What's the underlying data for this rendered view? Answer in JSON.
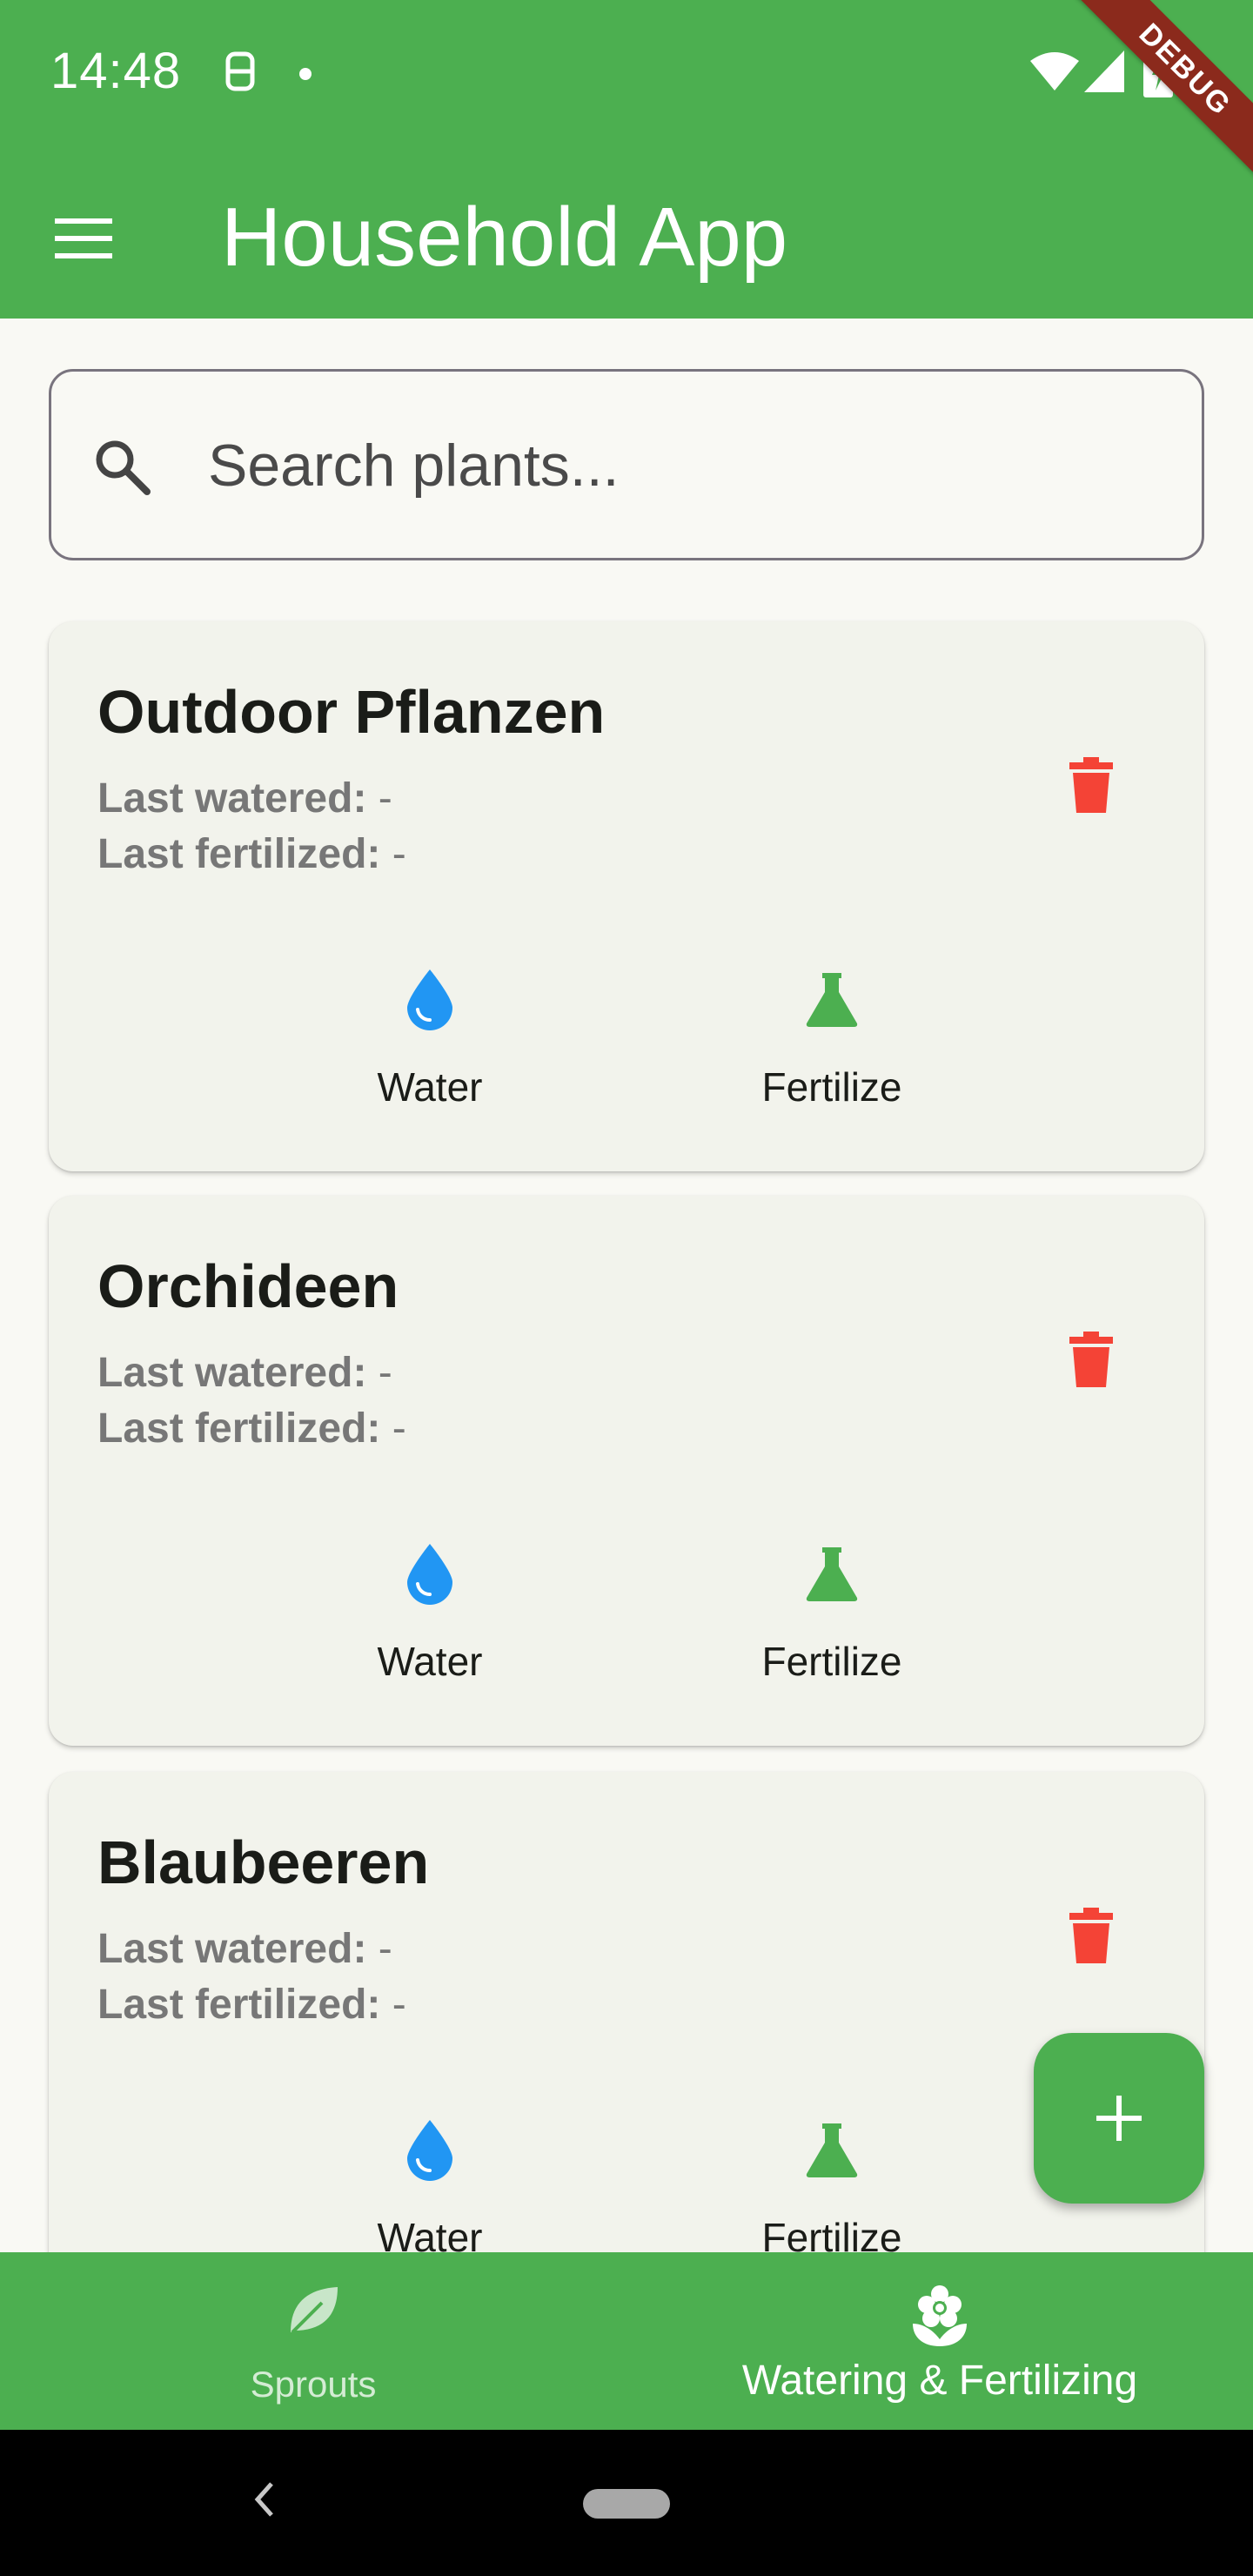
{
  "status_bar": {
    "time": "14:48",
    "icons": [
      "sim-icon",
      "notification-dot-icon",
      "wifi-icon",
      "signal-icon",
      "battery-charging-icon"
    ]
  },
  "debug_banner": "DEBUG",
  "app_bar": {
    "title": "Household App",
    "menu_icon": "menu-icon"
  },
  "search": {
    "placeholder": "Search plants...",
    "value": ""
  },
  "plants": [
    {
      "name": "Outdoor Pflanzen",
      "last_watered_label": "Last watered:",
      "last_watered": " -",
      "last_fertilized_label": "Last fertilized:",
      "last_fertilized": " -",
      "water_label": "Water",
      "fertilize_label": "Fertilize"
    },
    {
      "name": "Orchideen",
      "last_watered_label": "Last watered:",
      "last_watered": " -",
      "last_fertilized_label": "Last fertilized:",
      "last_fertilized": " -",
      "water_label": "Water",
      "fertilize_label": "Fertilize"
    },
    {
      "name": "Blaubeeren",
      "last_watered_label": "Last watered:",
      "last_watered": " -",
      "last_fertilized_label": "Last fertilized:",
      "last_fertilized": " -",
      "water_label": "Water",
      "fertilize_label": "Fertilize"
    }
  ],
  "fab": {
    "icon": "plus-icon"
  },
  "bottom_nav": {
    "items": [
      {
        "label": "Sprouts",
        "icon": "leaf-icon",
        "selected": false
      },
      {
        "label": "Watering & Fertilizing",
        "icon": "flower-icon",
        "selected": true
      }
    ]
  },
  "colors": {
    "primary": "#4caf50",
    "water": "#2196f3",
    "fertilize": "#4caf50",
    "delete": "#f44336",
    "card_bg": "#f2f3ec"
  }
}
